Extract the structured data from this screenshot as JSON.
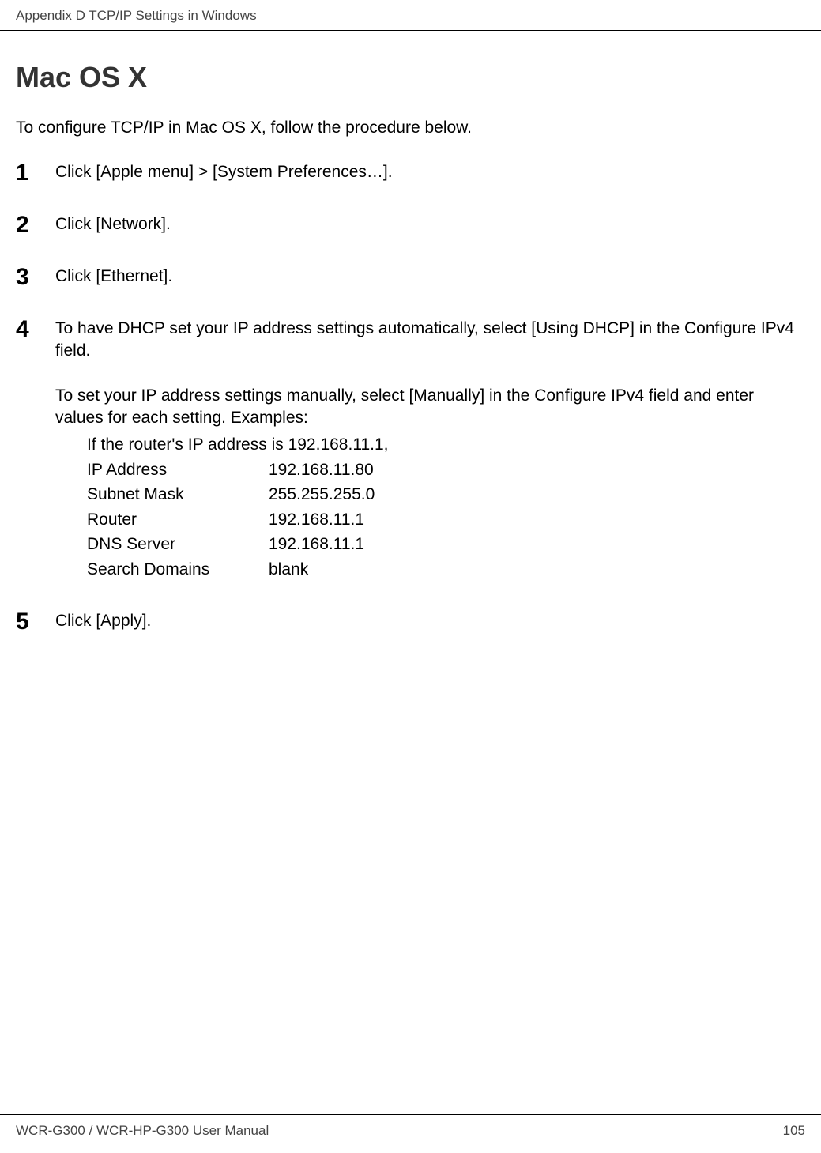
{
  "header": {
    "breadcrumb": "Appendix D  TCP/IP Settings in Windows"
  },
  "heading": "Mac OS X",
  "intro": "To configure TCP/IP in Mac OS X, follow the procedure below.",
  "steps": [
    {
      "num": "1",
      "text": "Click [Apple menu] > [System Preferences…]."
    },
    {
      "num": "2",
      "text": "Click [Network]."
    },
    {
      "num": "3",
      "text": "Click [Ethernet]."
    },
    {
      "num": "4",
      "text": "To have DHCP set your IP address settings automatically, select [Using DHCP] in the Configure IPv4 field.",
      "subtext": "To set your IP address settings manually, select [Manually] in the Configure IPv4 field and enter values for each setting.  Examples:",
      "example_intro": "If the router's IP address is 192.168.11.1,",
      "examples": [
        {
          "label": "IP Address",
          "value": "192.168.11.80"
        },
        {
          "label": "Subnet Mask",
          "value": "255.255.255.0"
        },
        {
          "label": "Router",
          "value": "192.168.11.1"
        },
        {
          "label": "DNS Server",
          "value": "192.168.11.1"
        },
        {
          "label": "Search Domains",
          "value": "blank"
        }
      ]
    },
    {
      "num": "5",
      "text": "Click [Apply]."
    }
  ],
  "footer": {
    "left": "WCR-G300 / WCR-HP-G300 User Manual",
    "right": "105"
  }
}
